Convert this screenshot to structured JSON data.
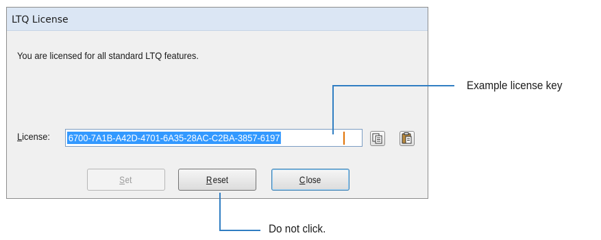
{
  "dialog": {
    "title": "LTQ License",
    "message": "You are licensed for all standard LTQ features.",
    "license_label_first": "L",
    "license_label_rest": "icense:",
    "license_value": "6700-7A1B-A42D-4701-6A35-28AC-C2BA-3857-6197",
    "buttons": {
      "set_first": "S",
      "set_rest": "et",
      "reset_first": "R",
      "reset_rest": "eset",
      "close_first": "C",
      "close_rest": "lose"
    }
  },
  "annotations": {
    "license_key": "Example license key",
    "do_not_click": "Do not click."
  },
  "colors": {
    "callout_line": "#2f7dc2",
    "selection": "#3399ff",
    "titlebar": "#dbe6f4"
  },
  "icons": [
    "copy-icon",
    "paste-icon"
  ]
}
